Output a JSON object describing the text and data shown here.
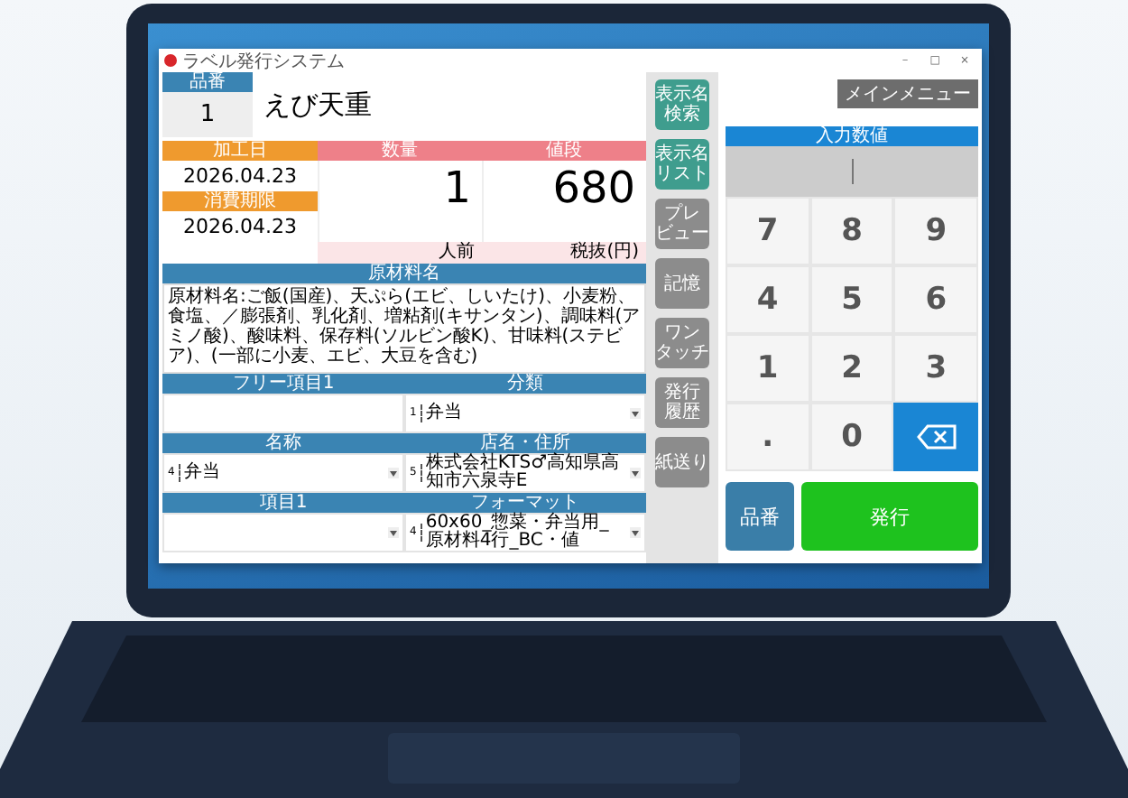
{
  "window": {
    "title": "ラベル発行システム",
    "controls": [
      "－",
      "□",
      "×"
    ]
  },
  "item_number": {
    "label": "品番",
    "value": "1"
  },
  "item_name": "えび天重",
  "dates": [
    {
      "label": "加工日",
      "value": "2026.04.23"
    },
    {
      "label": "消費期限",
      "value": "2026.04.23"
    }
  ],
  "quantity": {
    "label": "数量",
    "value": "1",
    "unit": "人前"
  },
  "price": {
    "label": "値段",
    "value": "680",
    "unit": "税抜(円)"
  },
  "ingredients": {
    "label": "原材料名",
    "value": "原材料名:ご飯(国産)、天ぷら(エビ、しいたけ)、小麦粉、食塩、／膨張剤、乳化剤、増粘剤(キサンタン)、調味料(アミノ酸)、酸味料、保存料(ソルビン酸K)、甘味料(ステビア)、(一部に小麦、エビ、大豆を含む)"
  },
  "fields": [
    {
      "label": "フリー項目1",
      "kind": "text"
    },
    {
      "label": "分類",
      "kind": "select",
      "index": "1",
      "value": "弁当"
    },
    {
      "label": "名称",
      "kind": "select",
      "index": "4",
      "value": "弁当"
    },
    {
      "label": "店名・住所",
      "kind": "select",
      "index": "5",
      "value": "株式会社KTS♂高知県高知市六泉寺E"
    },
    {
      "label": "項目1",
      "kind": "select"
    },
    {
      "label": "フォーマット",
      "kind": "select",
      "index": "4",
      "value": "60x60_惣菜・弁当用_原材料4行_BC・値"
    }
  ],
  "side_buttons": [
    {
      "lines": [
        "表示名",
        "検索"
      ],
      "color": "#3f9d8e"
    },
    {
      "lines": [
        "表示名",
        "リスト"
      ],
      "color": "#3f9d8e"
    },
    {
      "lines": [
        "プレ",
        "ビュー"
      ],
      "color": "#8c8c8c"
    },
    {
      "lines": [
        "記憶"
      ],
      "color": "#8c8c8c"
    },
    {
      "lines": [
        "ワン",
        "タッチ"
      ],
      "color": "#8c8c8c"
    },
    {
      "lines": [
        "発行",
        "履歴"
      ],
      "color": "#8c8c8c"
    },
    {
      "lines": [
        "紙送り"
      ],
      "color": "#8c8c8c"
    }
  ],
  "main_menu": "メインメニュー",
  "keypad": {
    "label": "入力数値",
    "keys": [
      {
        "kind": "digit",
        "label": "7"
      },
      {
        "kind": "digit",
        "label": "8"
      },
      {
        "kind": "digit",
        "label": "9"
      },
      {
        "kind": "digit",
        "label": "4"
      },
      {
        "kind": "digit",
        "label": "5"
      },
      {
        "kind": "digit",
        "label": "6"
      },
      {
        "kind": "digit",
        "label": "1"
      },
      {
        "kind": "digit",
        "label": "2"
      },
      {
        "kind": "digit",
        "label": "3"
      },
      {
        "kind": "digit",
        "label": "."
      },
      {
        "kind": "digit",
        "label": "0"
      },
      {
        "kind": "backspace"
      }
    ]
  },
  "actions": [
    {
      "label": "品番",
      "color": "#3a7ea8"
    },
    {
      "label": "発行",
      "color": "#1ec21e"
    }
  ]
}
